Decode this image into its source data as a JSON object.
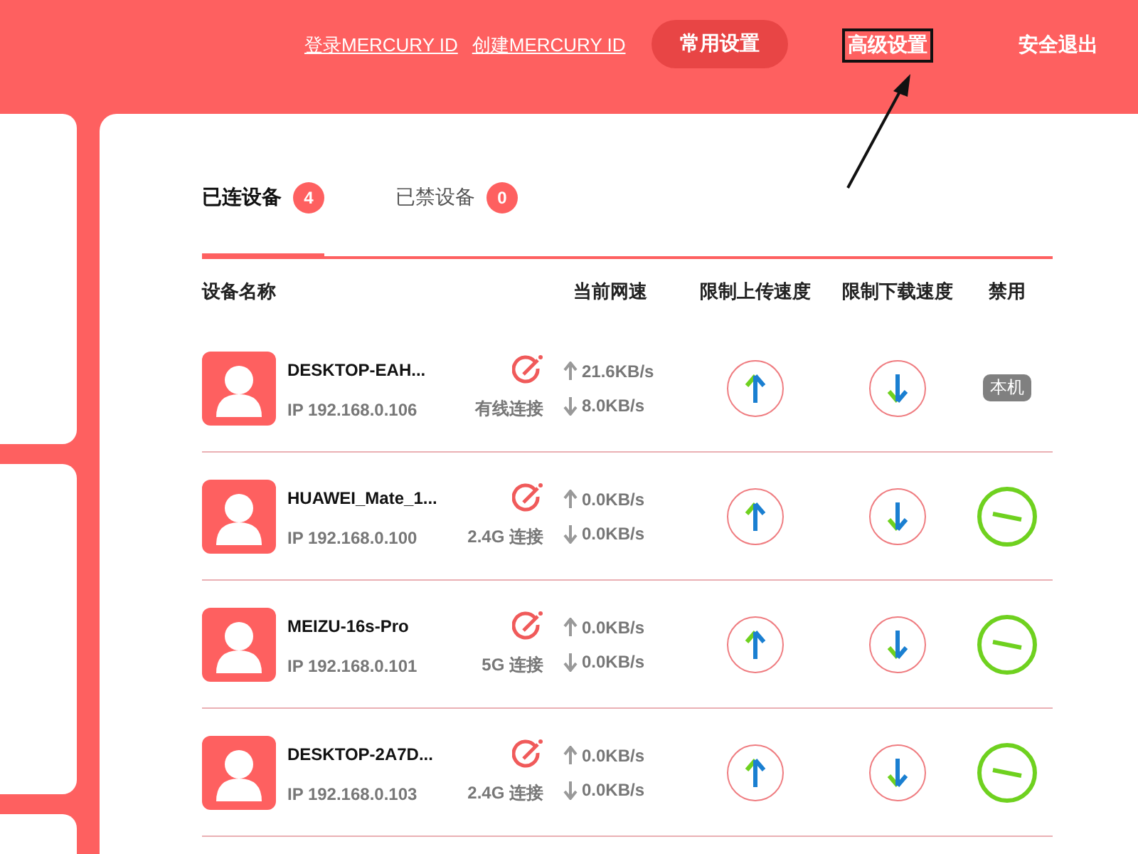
{
  "header": {
    "links": [
      {
        "label": "登录MERCURY ID"
      },
      {
        "label": "创建MERCURY ID"
      }
    ],
    "nav": [
      {
        "label": "常用设置",
        "selected": true,
        "highlighted": false
      },
      {
        "label": "高级设置",
        "selected": false,
        "highlighted": true
      },
      {
        "label": "安全退出",
        "selected": false,
        "highlighted": false
      }
    ]
  },
  "tabs": [
    {
      "label": "已连设备",
      "count": "4",
      "selected": true
    },
    {
      "label": "已禁设备",
      "count": "0",
      "selected": false
    }
  ],
  "table": {
    "columns": [
      "设备名称",
      "当前网速",
      "限制上传速度",
      "限制下载速度",
      "禁用"
    ],
    "rows": [
      {
        "name": "DESKTOP-EAH...",
        "ip": "IP 192.168.0.106",
        "connection": "有线连接",
        "upload": "21.6KB/s",
        "download": "8.0KB/s",
        "block": {
          "kind": "badge",
          "label": "本机"
        }
      },
      {
        "name": "HUAWEI_Mate_1...",
        "ip": "IP 192.168.0.100",
        "connection": "2.4G 连接",
        "upload": "0.0KB/s",
        "download": "0.0KB/s",
        "block": {
          "kind": "button"
        }
      },
      {
        "name": "MEIZU-16s-Pro",
        "ip": "IP 192.168.0.101",
        "connection": "5G 连接",
        "upload": "0.0KB/s",
        "download": "0.0KB/s",
        "block": {
          "kind": "button"
        }
      },
      {
        "name": "DESKTOP-2A7D...",
        "ip": "IP 192.168.0.103",
        "connection": "2.4G 连接",
        "upload": "0.0KB/s",
        "download": "0.0KB/s",
        "block": {
          "kind": "button"
        }
      }
    ]
  }
}
